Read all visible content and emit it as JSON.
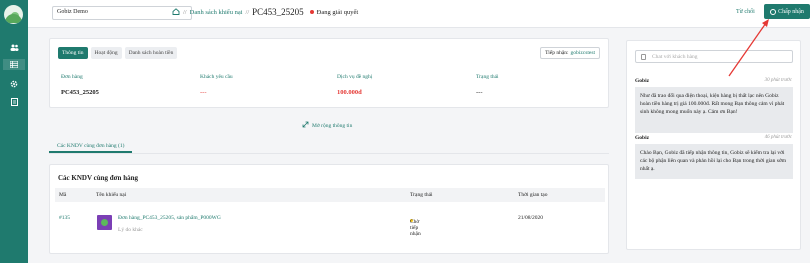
{
  "topbar": {
    "workspace": "Gobiz Demo",
    "breadcrumb": [
      "Danh sách khiếu nại",
      "PC453_25205"
    ],
    "status": "Đang giải quyết",
    "reject": "Từ chối",
    "accept": "Chấp nhận"
  },
  "sidebar": {
    "icons": [
      "people-icon",
      "list-icon",
      "settings-icon",
      "document-icon"
    ]
  },
  "detail": {
    "tabs": [
      "Thông tin",
      "Hoạt động",
      "Danh sách hoàn tiền"
    ],
    "receiver_label": "Tiếp nhận:",
    "receiver_value": "gobizcstest",
    "fields": [
      {
        "label": "Đơn hàng",
        "value": "PC453_25205"
      },
      {
        "label": "Khách yêu cầu",
        "value": "---"
      },
      {
        "label": "Dịch vụ đề nghị",
        "value": "100.000đ"
      },
      {
        "label": "Trạng thái",
        "value": "---"
      }
    ],
    "expand": "Mở rộng thông tin"
  },
  "related": {
    "tab": "Các KNDV cùng đơn hàng (1)",
    "heading": "Các KNDV cùng đơn hàng",
    "columns": [
      "Mã",
      "Tên khiếu nại",
      "Trạng thái",
      "Thời gian tạo"
    ],
    "rows": [
      {
        "code": "#135",
        "title": "Đơn hàng_PC453_25205, sản phẩm_P000WG",
        "reason": "Lý do khác",
        "status": "Chờ tiếp nhận",
        "created": "21/08/2020"
      }
    ]
  },
  "chat": {
    "placeholder": "Chat với khách hàng",
    "messages": [
      {
        "sender": "Gobiz",
        "time": "30 phút trước",
        "text": "Như đã trao đổi qua điện thoại, kiện hàng bị thất lạc nên Gobiz hoàn tiền hàng trị giá 100.000đ. Rất mong Bạn thông cảm vì phát sinh không mong muốn này ạ. Cảm ơn Bạn!"
      },
      {
        "sender": "Gobiz",
        "time": "46 phút trước",
        "text": "Chào Bạn, Gobiz đã tiếp nhận thông tin, Gobiz sẽ kiểm tra lại với các bộ phận liên quan và phản hồi lại cho Bạn trong thời gian sớm nhất ạ."
      }
    ]
  },
  "colors": {
    "primary": "#1f7a6e",
    "danger": "#e53935",
    "pending": "#f2c21b"
  }
}
